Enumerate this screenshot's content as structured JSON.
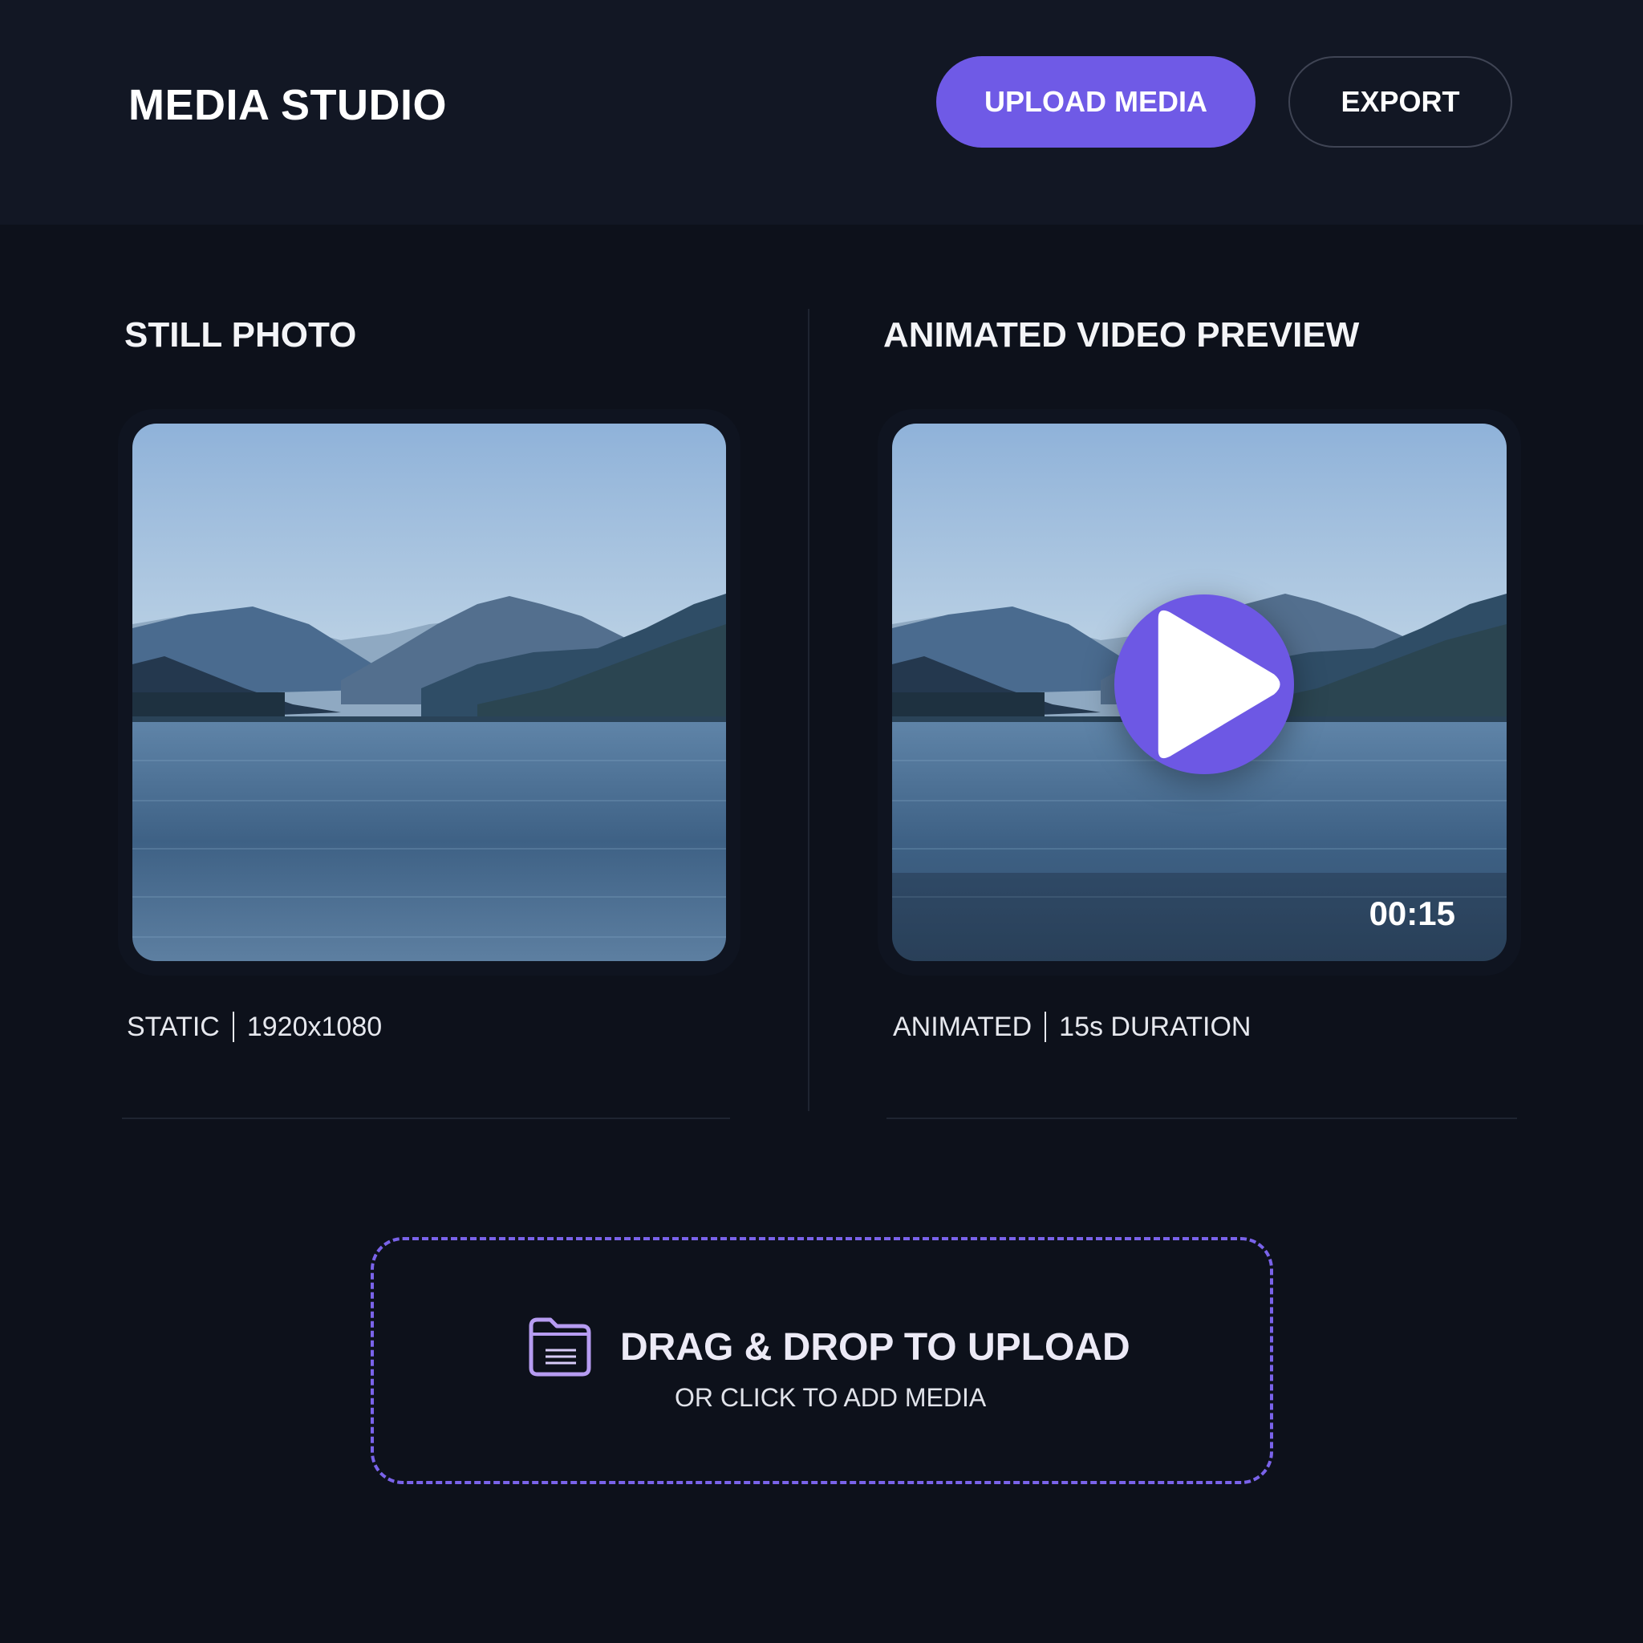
{
  "header": {
    "title": "MEDIA STUDIO",
    "upload_label": "UPLOAD MEDIA",
    "export_label": "EXPORT"
  },
  "still": {
    "title": "STILL PHOTO",
    "caption_type": "STATIC",
    "caption_detail": "1920x1080"
  },
  "video": {
    "title": "ANIMATED VIDEO PREVIEW",
    "timestamp": "00:15",
    "caption_type": "ANIMATED",
    "caption_detail": "15s DURATION"
  },
  "dropzone": {
    "title": "DRAG & DROP TO UPLOAD",
    "subtitle": "OR CLICK TO ADD MEDIA"
  },
  "icons": {
    "play": "play-icon",
    "folder": "folder-icon"
  },
  "colors": {
    "background": "#0d111b",
    "header": "#121724",
    "accent": "#6f5ae6",
    "dropzone_border": "#7a63ea"
  }
}
